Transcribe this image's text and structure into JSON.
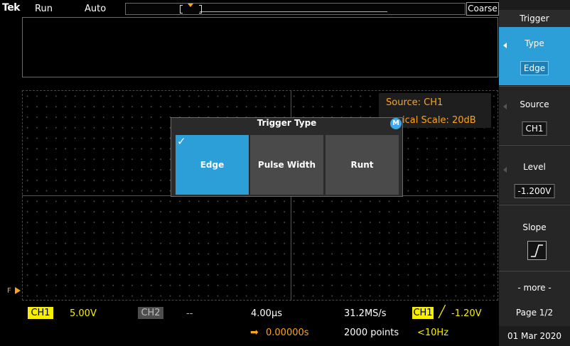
{
  "top": {
    "logo": "Tek",
    "run_state": "Run",
    "acq_mode": "Auto",
    "coarse": "Coarse"
  },
  "readout": {
    "source": "Source: CH1",
    "scale": "ical Scale: 20dB"
  },
  "dialog": {
    "title": "Trigger Type",
    "badge": "M",
    "options": [
      {
        "label": "Edge",
        "selected": true
      },
      {
        "label": "Pulse Width",
        "selected": false
      },
      {
        "label": "Runt",
        "selected": false
      }
    ]
  },
  "bottom": {
    "ch1_label": "CH1",
    "ch1_scale": "5.00V",
    "ch2_label": "CH2",
    "ch2_scale": "--",
    "horiz_scale": "4.00µs",
    "horiz_pos": "0.00000s",
    "sample_rate": "31.2MS/s",
    "record_length": "2000 points",
    "trig_source": "CH1",
    "trig_level": "-1.20V",
    "trig_freq": "<10Hz"
  },
  "side_menu": {
    "title": "Trigger",
    "type_label": "Type",
    "type_value": "Edge",
    "source_label": "Source",
    "source_value": "CH1",
    "level_label": "Level",
    "level_value": "-1.200V",
    "slope_label": "Slope",
    "more_label": "- more -",
    "page_label": "Page 1/2"
  },
  "date": "01 Mar 2020",
  "graticule_marker": "F",
  "colors": {
    "ch1": "#f6ef00",
    "trigger": "#ffa318",
    "accent": "#2c9ed8"
  }
}
